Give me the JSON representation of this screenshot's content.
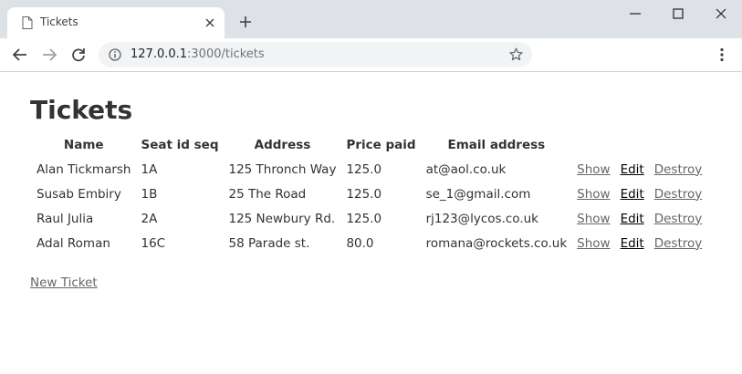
{
  "browser": {
    "tab_title": "Tickets",
    "url_host": "127.0.0.1",
    "url_path": ":3000/tickets"
  },
  "page": {
    "title": "Tickets",
    "columns": [
      "Name",
      "Seat id seq",
      "Address",
      "Price paid",
      "Email address"
    ],
    "rows": [
      {
        "name": "Alan Tickmarsh",
        "seat": "1A",
        "address": "125 Thronch Way",
        "price": "125.0",
        "email": "at@aol.co.uk",
        "show": "Show",
        "edit": "Edit",
        "destroy": "Destroy"
      },
      {
        "name": "Susab Embiry",
        "seat": "1B",
        "address": "25 The Road",
        "price": "125.0",
        "email": "se_1@gmail.com",
        "show": "Show",
        "edit": "Edit",
        "destroy": "Destroy"
      },
      {
        "name": "Raul Julia",
        "seat": "2A",
        "address": "125 Newbury Rd.",
        "price": "125.0",
        "email": "rj123@lycos.co.uk",
        "show": "Show",
        "edit": "Edit",
        "destroy": "Destroy"
      },
      {
        "name": "Adal Roman",
        "seat": "16C",
        "address": "58 Parade st.",
        "price": "80.0",
        "email": "romana@rockets.co.uk",
        "show": "Show",
        "edit": "Edit",
        "destroy": "Destroy"
      }
    ],
    "new_link": "New Ticket"
  },
  "icons": {
    "tab": "document-icon",
    "tab_close": "close-icon",
    "new_tab": "plus-icon",
    "back": "arrow-left-icon",
    "forward": "arrow-right-icon",
    "reload": "reload-icon",
    "info": "info-icon",
    "bookmark": "star-icon",
    "menu": "kebab-menu-icon"
  }
}
